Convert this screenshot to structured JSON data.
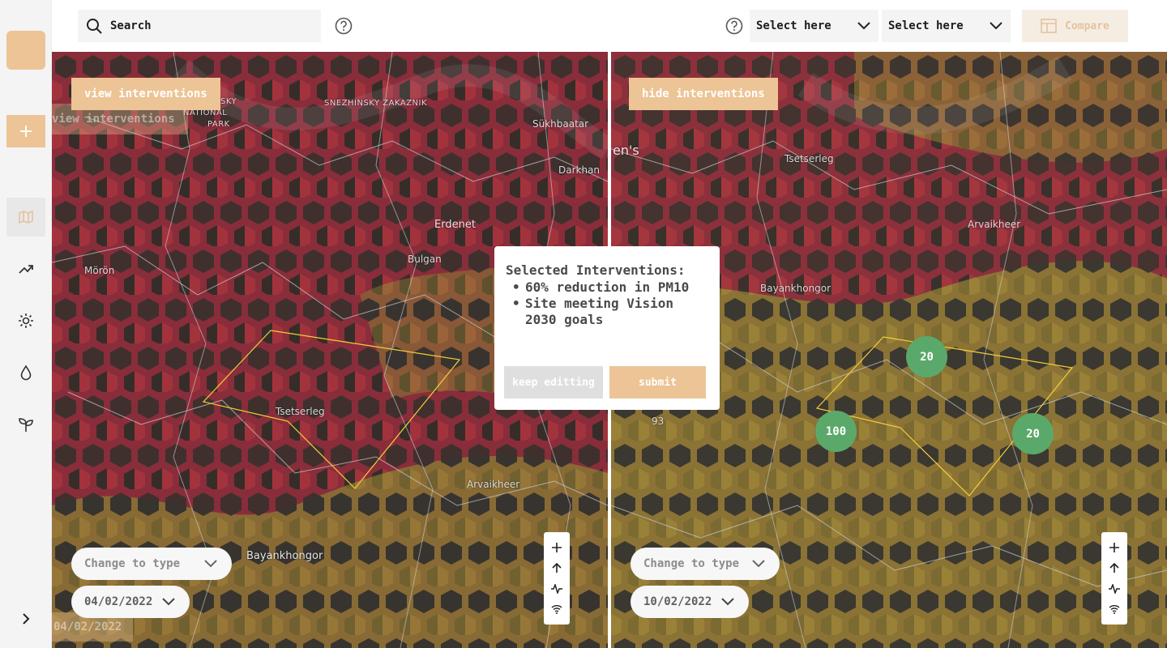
{
  "header": {
    "search": {
      "label": "Search"
    },
    "select_1": {
      "value": "Select here"
    },
    "select_2": {
      "value": "Select here"
    },
    "compare_label": "Compare"
  },
  "sidebar": {
    "items": [
      {
        "icon": "map-icon",
        "active": true
      },
      {
        "icon": "trending-up-icon"
      },
      {
        "icon": "sun-icon"
      },
      {
        "icon": "droplet-icon"
      },
      {
        "icon": "sprout-icon"
      }
    ]
  },
  "left_map": {
    "toggle_label": "view interventions",
    "ghost_toggle_label": "view interventions",
    "type_select": "Change to type",
    "date": "04/02/2022",
    "ghost_date": "04/02/2022",
    "places": {
      "snezhinsky": "SNEZHINSKY ZAKAZNIK",
      "park_a": "SKY",
      "park_b": "NATIONAL",
      "park_c": "PARK",
      "sukhbaatar": "Sükhbaatar",
      "darkhan": "Darkhan",
      "erdenet": "Erdenet",
      "bulgan": "Bulgan",
      "murun": "Mörön",
      "tsetserleg": "Tsetserleg",
      "arvaikheer": "Arvaikheer",
      "bayankhongor": "Bayankhongor"
    }
  },
  "right_map": {
    "toggle_label": "hide interventions",
    "type_select": "Change to type",
    "date": "10/02/2022",
    "places": {
      "tsetserleg": "Tsetserleg",
      "arvaikheer": "Arvaikheer",
      "bayankhongor": "Bayankhongor",
      "ens": "en's",
      "road": "93"
    },
    "markers": [
      "20",
      "100",
      "20"
    ]
  },
  "modal": {
    "title": "Selected Interventions:",
    "items": [
      "60% reduction in PM10",
      "Site meeting Vision 2030 goals"
    ],
    "keep_label": "keep editting",
    "submit_label": "submit"
  },
  "colors": {
    "accent": "#ecc495",
    "map_red": "#8a1f3a",
    "map_olive": "#8a7a2a",
    "marker_green": "#5aa96a"
  }
}
